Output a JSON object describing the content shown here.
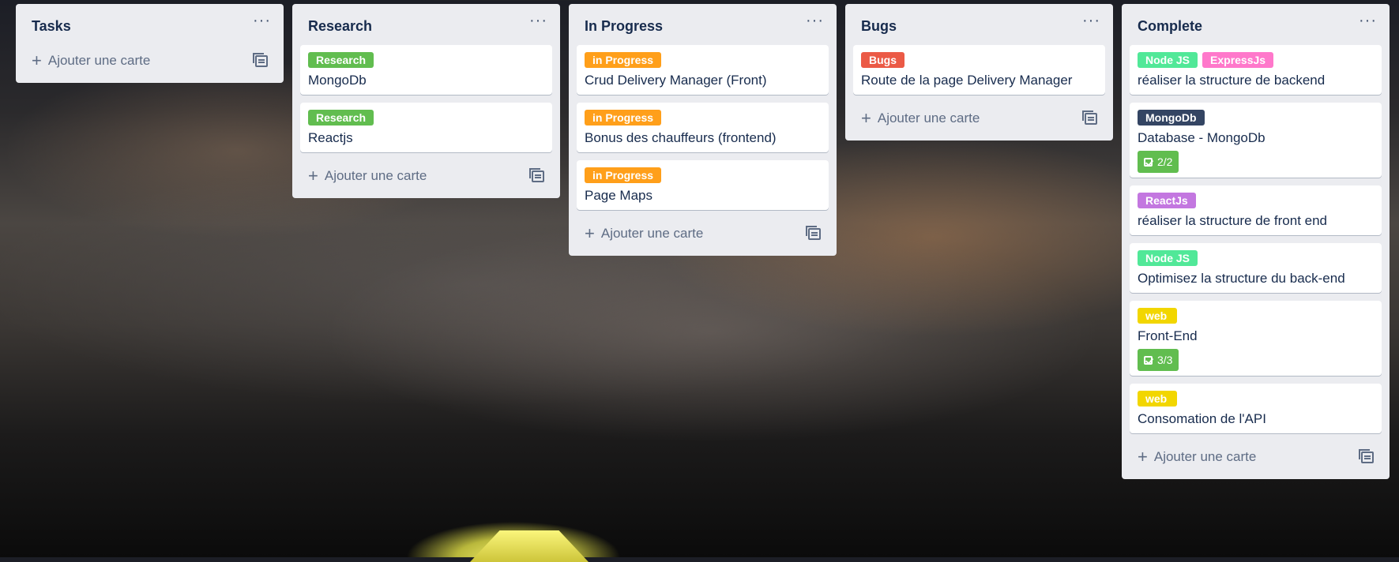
{
  "add_card_label": "Ajouter une carte",
  "menu_glyph": "···",
  "lists": [
    {
      "title": "Tasks",
      "cards": []
    },
    {
      "title": "Research",
      "cards": [
        {
          "labels": [
            {
              "text": "Research",
              "color": "#61bd4f"
            }
          ],
          "title": "MongoDb"
        },
        {
          "labels": [
            {
              "text": "Research",
              "color": "#61bd4f"
            }
          ],
          "title": "Reactjs"
        }
      ]
    },
    {
      "title": "In Progress",
      "cards": [
        {
          "labels": [
            {
              "text": "in Progress",
              "color": "#ff9f1a"
            }
          ],
          "title": "Crud Delivery Manager (Front)"
        },
        {
          "labels": [
            {
              "text": "in Progress",
              "color": "#ff9f1a"
            }
          ],
          "title": "Bonus des chauffeurs (frontend)"
        },
        {
          "labels": [
            {
              "text": "in Progress",
              "color": "#ff9f1a"
            }
          ],
          "title": "Page Maps"
        }
      ]
    },
    {
      "title": "Bugs",
      "cards": [
        {
          "labels": [
            {
              "text": "Bugs",
              "color": "#eb5a46"
            }
          ],
          "title": "Route de la page Delivery Manager"
        }
      ]
    },
    {
      "title": "Complete",
      "cards": [
        {
          "labels": [
            {
              "text": "Node JS",
              "color": "#51e898"
            },
            {
              "text": "ExpressJs",
              "color": "#ff78cb"
            }
          ],
          "title": "réaliser la structure de backend"
        },
        {
          "labels": [
            {
              "text": "MongoDb",
              "color": "#344563"
            }
          ],
          "title": "Database - MongoDb",
          "checklist": "2/2"
        },
        {
          "labels": [
            {
              "text": "ReactJs",
              "color": "#c377e0"
            }
          ],
          "title": "réaliser la structure de front end"
        },
        {
          "labels": [
            {
              "text": "Node JS",
              "color": "#51e898"
            }
          ],
          "title": "Optimisez la structure du back-end"
        },
        {
          "labels": [
            {
              "text": "web",
              "color": "#f2d600"
            }
          ],
          "title": "Front-End",
          "checklist": "3/3"
        },
        {
          "labels": [
            {
              "text": "web",
              "color": "#f2d600"
            }
          ],
          "title": "Consomation de l'API"
        }
      ]
    }
  ]
}
